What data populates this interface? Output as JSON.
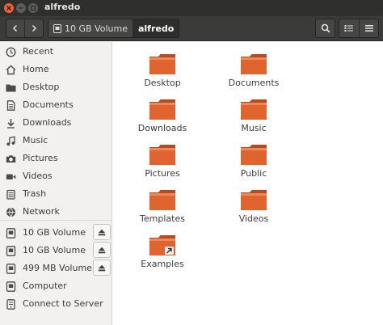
{
  "window": {
    "title": "alfredo"
  },
  "path": {
    "volume": "10 GB Volume",
    "folder": "alfredo"
  },
  "sidebar": {
    "places": [
      {
        "label": "Recent",
        "icon": "clock-icon"
      },
      {
        "label": "Home",
        "icon": "home-icon"
      },
      {
        "label": "Desktop",
        "icon": "desktop-folder-icon"
      },
      {
        "label": "Documents",
        "icon": "documents-icon"
      },
      {
        "label": "Downloads",
        "icon": "download-icon"
      },
      {
        "label": "Music",
        "icon": "music-icon"
      },
      {
        "label": "Pictures",
        "icon": "camera-icon"
      },
      {
        "label": "Videos",
        "icon": "video-icon"
      },
      {
        "label": "Trash",
        "icon": "trash-icon"
      },
      {
        "label": "Network",
        "icon": "network-icon"
      }
    ],
    "devices": [
      {
        "label": "10 GB Volume",
        "icon": "drive-icon",
        "eject": true
      },
      {
        "label": "10 GB Volume",
        "icon": "drive-icon",
        "eject": true
      },
      {
        "label": "499 MB Volume",
        "icon": "drive-icon",
        "eject": true
      },
      {
        "label": "Computer",
        "icon": "drive-icon",
        "eject": false
      },
      {
        "label": "Connect to Server",
        "icon": "server-icon",
        "eject": false
      }
    ]
  },
  "files": [
    {
      "label": "Desktop"
    },
    {
      "label": "Documents"
    },
    {
      "label": "Downloads"
    },
    {
      "label": "Music"
    },
    {
      "label": "Pictures"
    },
    {
      "label": "Public"
    },
    {
      "label": "Templates"
    },
    {
      "label": "Videos"
    },
    {
      "label": "Examples",
      "link": true
    }
  ],
  "colors": {
    "folder": "#e0642f",
    "titlebar": "#2f2f2d",
    "close": "#e9643a",
    "sidebar": "#f2f1f0"
  }
}
